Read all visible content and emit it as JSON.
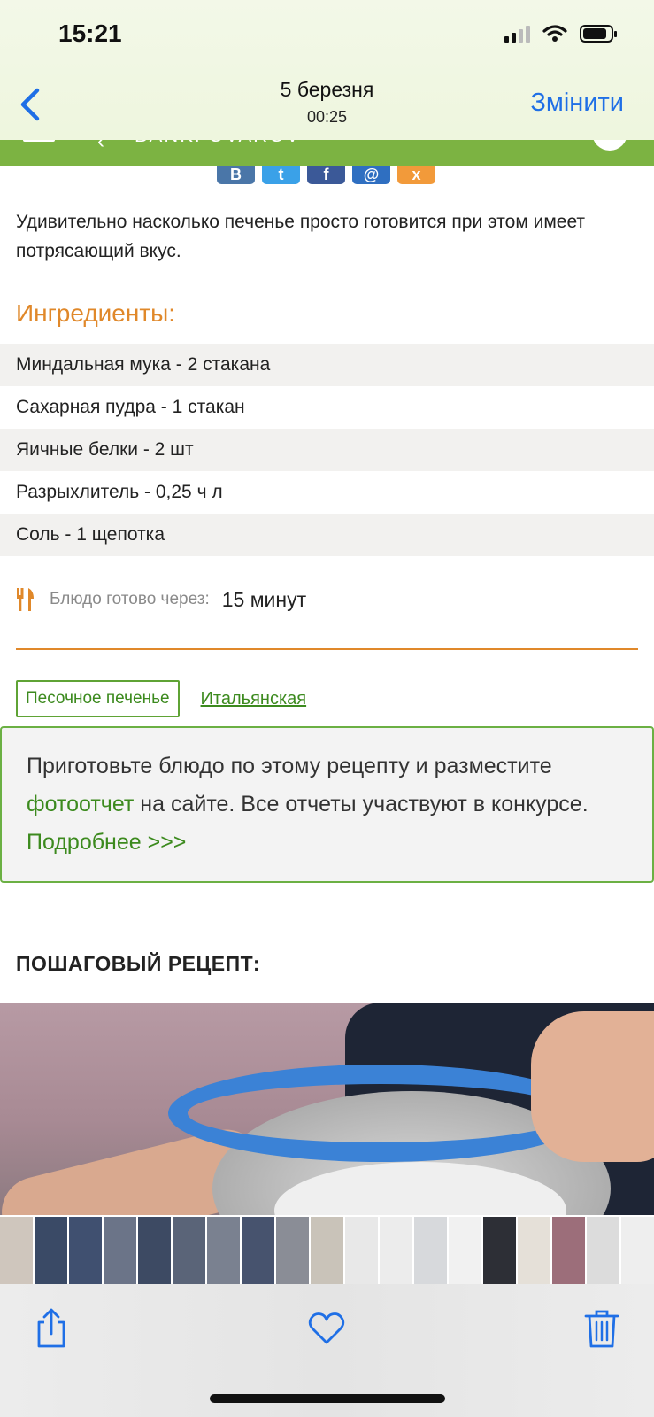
{
  "status": {
    "time": "15:21"
  },
  "nav": {
    "title": "5 березня",
    "subtitle": "00:25",
    "edit_label": "Змінити"
  },
  "site_header": {
    "brand": "BANKFOVAROV"
  },
  "share_buttons": [
    {
      "name": "vk",
      "label": "В",
      "color": "#4a76a8"
    },
    {
      "name": "twitter",
      "label": "t",
      "color": "#3aa1e8"
    },
    {
      "name": "facebook",
      "label": "f",
      "color": "#3b5998"
    },
    {
      "name": "mail",
      "label": "@",
      "color": "#2f6fc1"
    },
    {
      "name": "odnoklassniki",
      "label": "x",
      "color": "#f29a3a"
    }
  ],
  "intro_text": "Удивительно насколько печенье просто готовится при этом имеет потрясающий вкус.",
  "ingredients": {
    "title": "Ингредиенты:",
    "items": [
      "Миндальная мука - 2 стакана",
      "Сахарная пудра - 1 стакан",
      "Яичные белки - 2 шт",
      "Разрыхлитель - 0,25 ч л",
      "Соль - 1 щепотка"
    ]
  },
  "ready": {
    "label": "Блюдо готово через:",
    "value": "15 минут"
  },
  "tags": {
    "category": "Песочное печенье",
    "cuisine": "Итальянская"
  },
  "promo": {
    "part1": "Приготовьте блюдо по этому рецепту и разместите ",
    "link1": "фотоотчет",
    "part2": " на сайте. Все отчеты участвуют в конкурсе. ",
    "link2": "Подробнее >>>"
  },
  "step_title": "ПОШАГОВЫЙ РЕЦЕПТ:",
  "thumbnail_colors": [
    "#cfc6bd",
    "#3a4a66",
    "#405070",
    "#6b7488",
    "#3d4a63",
    "#5a6478",
    "#7a8190",
    "#47536e",
    "#8a8d96",
    "#c9c3b9",
    "#e8e8e8",
    "#ececec",
    "#d7d9dc",
    "#f1f1f1",
    "#2d2f36",
    "#e5e0d8",
    "#9c6e7a",
    "#dcdcdc",
    "#eeeeee",
    "#b5946f",
    "#a78963",
    "#9c9aa0",
    "#cfcfcf",
    "#b9b9bc",
    "#8e8f93",
    "#a4a09a",
    "#c8c2ba"
  ]
}
